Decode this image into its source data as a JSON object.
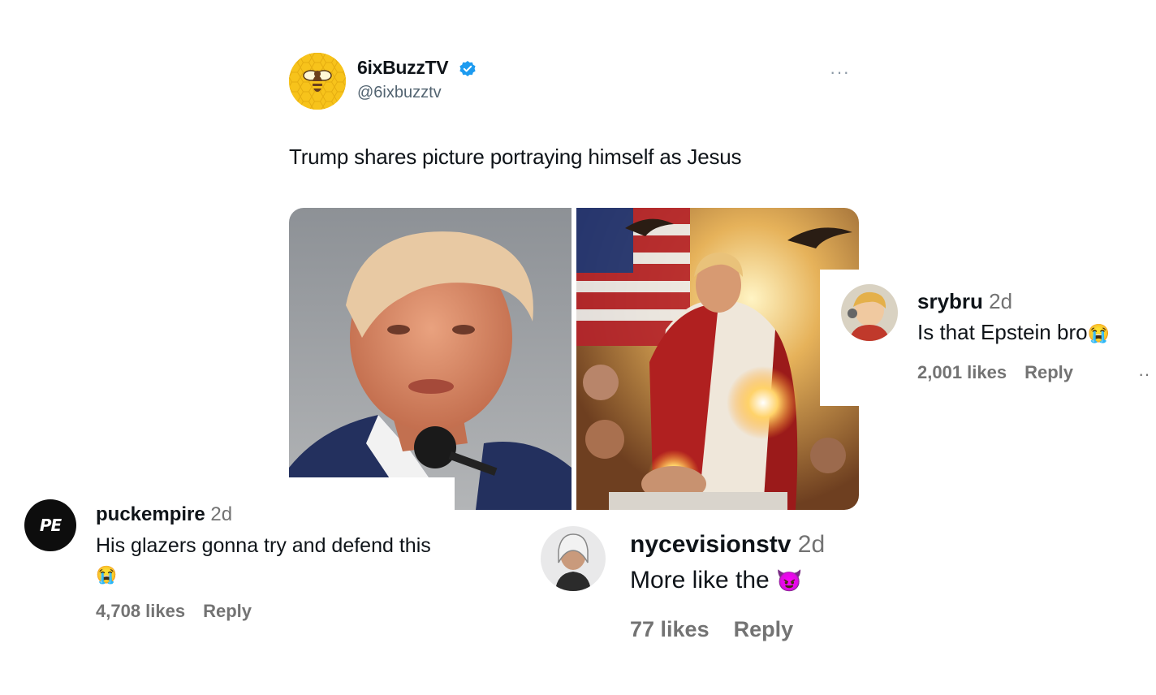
{
  "tweet": {
    "display_name": "6ixBuzzTV",
    "handle": "@6ixbuzztv",
    "more": "···",
    "text": "Trump shares picture portraying himself as Jesus"
  },
  "comments": [
    {
      "username": "srybru",
      "time": "2d",
      "text": "Is that Epstein bro",
      "emoji": "😭",
      "likes": "2,001 likes",
      "reply": "Reply",
      "more": "··"
    },
    {
      "username": "puckempire",
      "time": "2d",
      "text": "His glazers gonna try and defend this",
      "emoji": "😭",
      "likes": "4,708 likes",
      "reply": "Reply",
      "avatar_text": "PE"
    },
    {
      "username": "nycevisionstv",
      "time": "2d",
      "text": "More like the",
      "emoji": "😈",
      "likes": "77 likes",
      "reply": "Reply"
    }
  ],
  "colors": {
    "brand_yellow": "#f7c31b",
    "verified_blue": "#1d9bf0",
    "meta_gray": "#737373"
  }
}
